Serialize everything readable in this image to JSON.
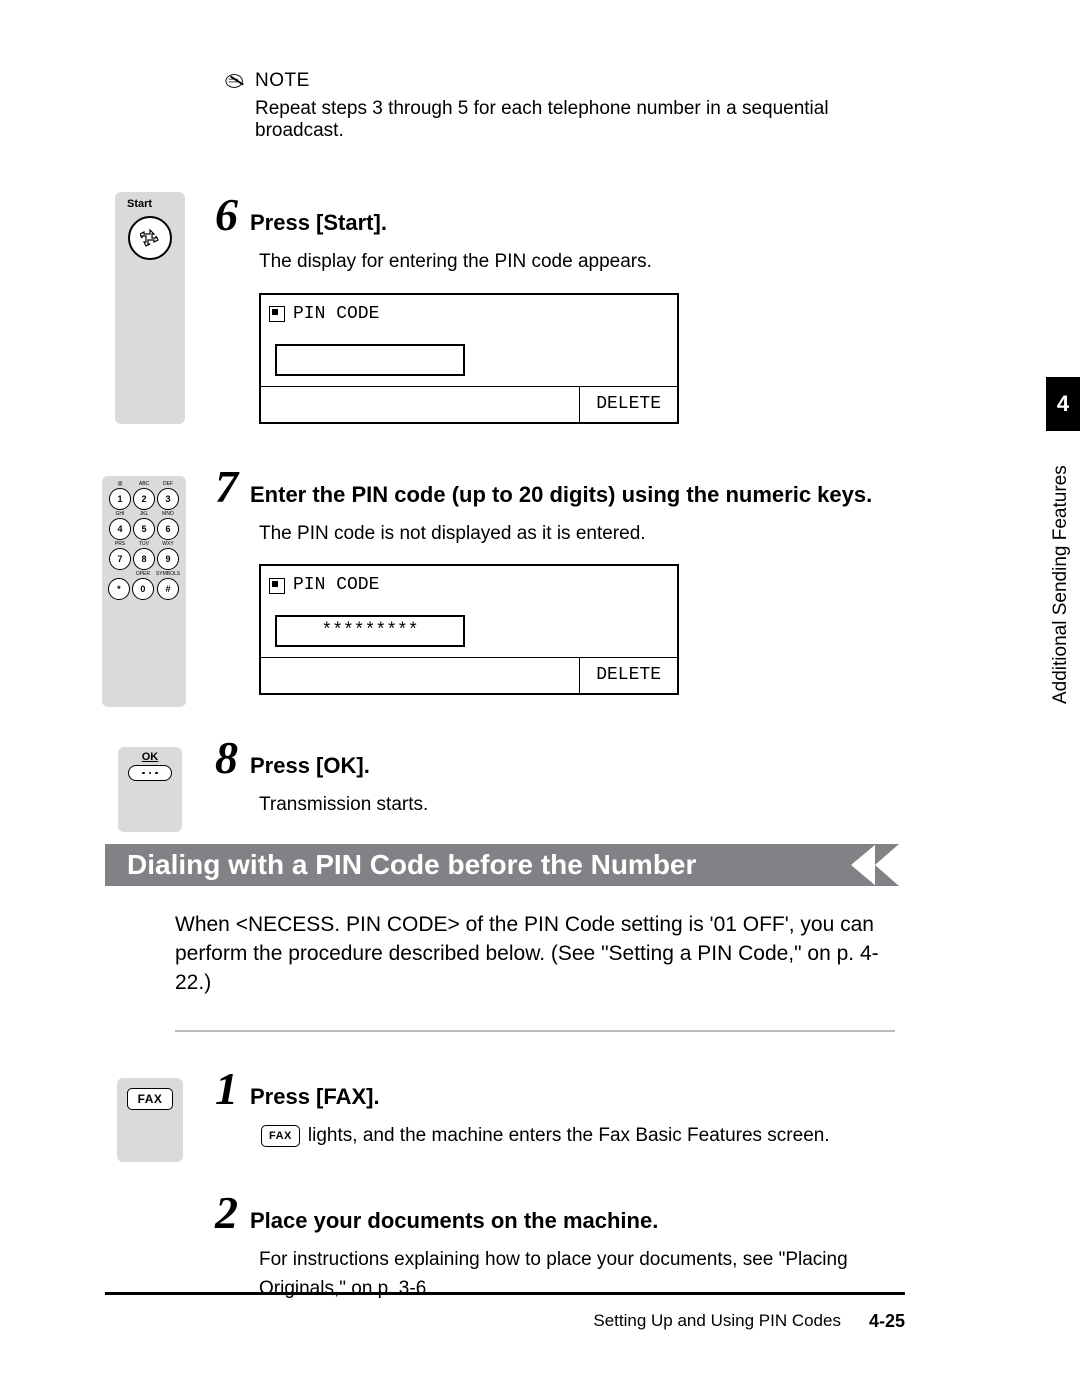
{
  "note": {
    "label": "NOTE",
    "text": "Repeat steps 3 through 5 for each telephone number in a sequential broadcast."
  },
  "steps": {
    "s6": {
      "num": "6",
      "title": "Press [Start].",
      "body": "The display for entering the PIN code appears.",
      "panel_label": "PIN CODE",
      "panel_input": "",
      "panel_delete": "DELETE",
      "icon_label": "Start"
    },
    "s7": {
      "num": "7",
      "title": "Enter the PIN code (up to 20 digits) using the numeric keys.",
      "body": "The PIN code is not displayed as it is entered.",
      "panel_label": "PIN CODE",
      "panel_input": "*********",
      "panel_delete": "DELETE"
    },
    "s8": {
      "num": "8",
      "title": "Press [OK].",
      "body": "Transmission starts.",
      "icon_label": "OK"
    }
  },
  "section": {
    "title": "Dialing with a PIN Code before the Number",
    "intro": "When <NECESS. PIN CODE> of the PIN Code setting is '01 OFF', you can perform the procedure described below. (See \"Setting a PIN Code,\" on p. 4-22.)"
  },
  "sub_steps": {
    "s1": {
      "num": "1",
      "title": "Press [FAX].",
      "fax_label": "FAX",
      "body_suffix": " lights, and the machine enters the Fax Basic Features screen."
    },
    "s2": {
      "num": "2",
      "title": "Place your documents on the machine.",
      "body": "For instructions explaining how to place your documents, see \"Placing Originals,\" on p. 3-6."
    }
  },
  "side": {
    "tab": "4",
    "text": "Additional Sending Features"
  },
  "footer": {
    "section": "Setting Up and Using PIN Codes",
    "page": "4-25"
  },
  "keypad": {
    "labels": [
      "@",
      "ABC",
      "DEF",
      "GHI",
      "JKL",
      "MNO",
      "PRS",
      "TUV",
      "WXY",
      "",
      "OPER",
      "SYMBOLS"
    ],
    "keys": [
      "1",
      "2",
      "3",
      "4",
      "5",
      "6",
      "7",
      "8",
      "9",
      "*",
      "0",
      "#"
    ]
  }
}
